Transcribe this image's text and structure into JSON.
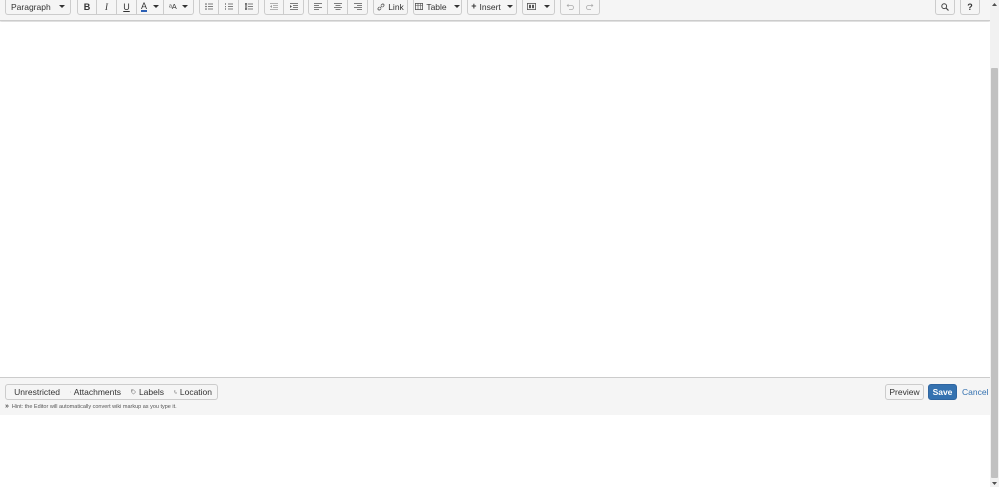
{
  "toolbar": {
    "format": "Paragraph",
    "link": "Link",
    "table": "Table",
    "insert": "Insert",
    "icons": [
      "bold-icon",
      "italic-icon",
      "underline-icon",
      "text-color-icon",
      "text-format-icon",
      "bullet-list-icon",
      "numbered-list-icon",
      "task-list-icon",
      "outdent-icon",
      "indent-icon",
      "align-left-icon",
      "align-center-icon",
      "align-right-icon",
      "link-icon",
      "table-icon",
      "plus-icon",
      "page-layout-icon",
      "undo-icon",
      "redo-icon",
      "search-icon",
      "help-icon"
    ]
  },
  "footer": {
    "restrictions": "Unrestricted",
    "attachments": "Attachments",
    "labels": "Labels",
    "location": "Location",
    "preview": "Preview",
    "save": "Save",
    "cancel": "Cancel",
    "hint": "Hint: the Editor will automatically convert wiki markup as you type it."
  },
  "colors": {
    "toolbar_bg": "#f5f5f5",
    "border": "#cccccc",
    "save_bg": "#3572b0",
    "link": "#3572b0"
  }
}
